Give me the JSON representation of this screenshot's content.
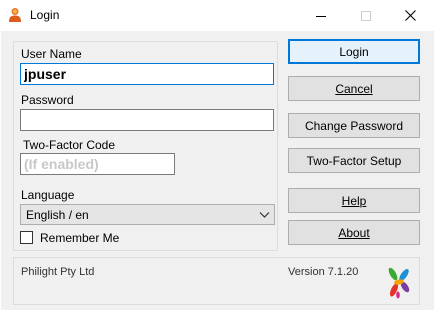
{
  "window": {
    "title": "Login",
    "icon": "user-icon"
  },
  "form": {
    "username_label": "User Name",
    "username_value": "jpuser",
    "password_label": "Password",
    "password_value": "",
    "twofactor_label": "Two-Factor Code",
    "twofactor_placeholder": "(If enabled)",
    "language_label": "Language",
    "language_value": "English / en",
    "remember_label": "Remember Me",
    "remember_checked": false
  },
  "buttons": {
    "login": "Login",
    "cancel": "Cancel",
    "change_password": "Change Password",
    "twofactor_setup": "Two-Factor Setup",
    "help": "Help",
    "about": "About"
  },
  "footer": {
    "company": "Philight Pty Ltd",
    "version": "Version 7.1.20"
  },
  "colors": {
    "accent": "#0078d7",
    "window_bg": "#f0f0f0"
  }
}
